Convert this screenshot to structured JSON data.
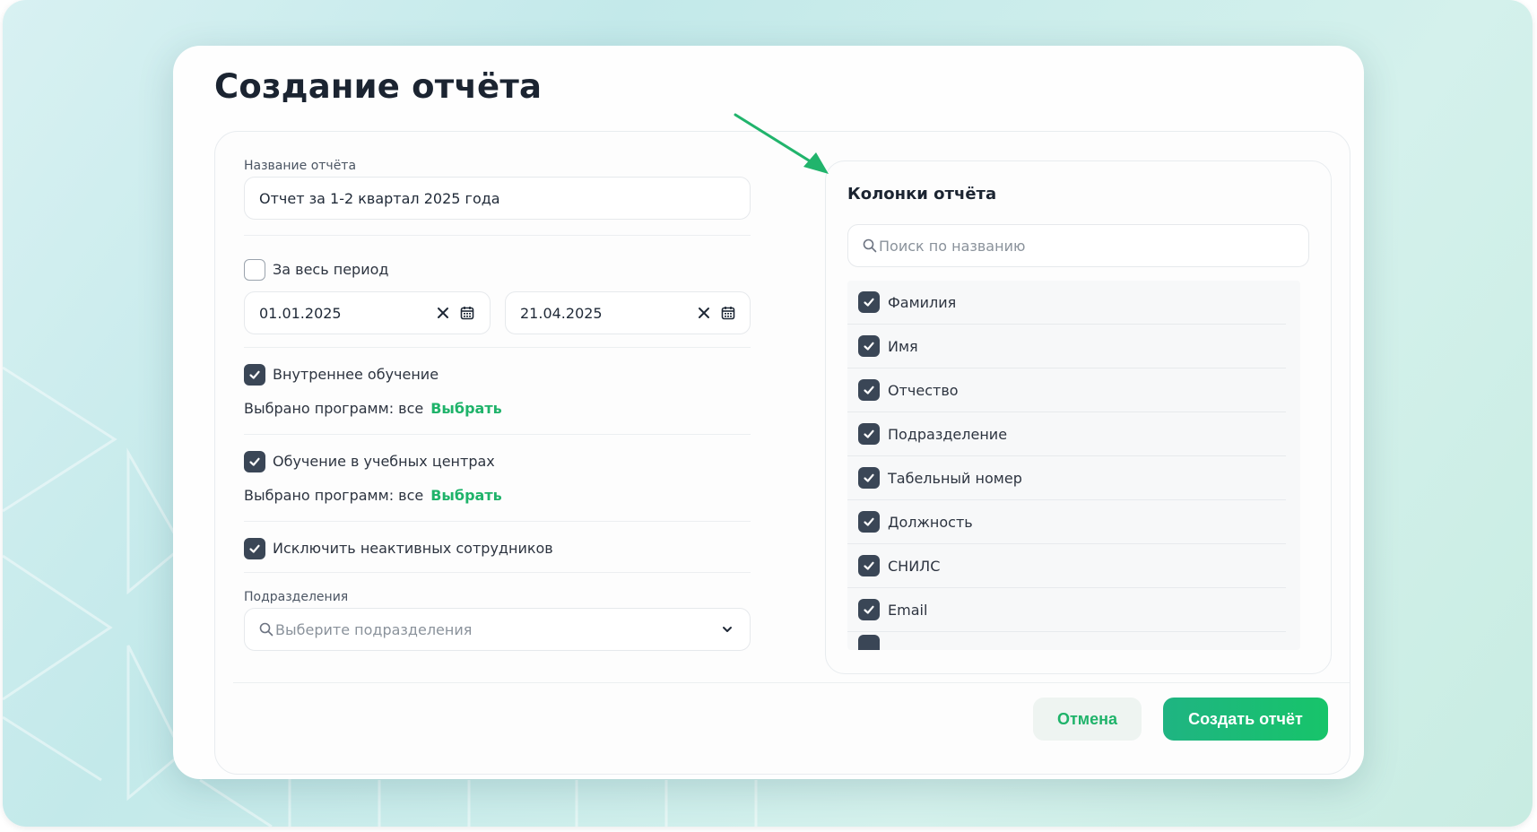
{
  "modal": {
    "title": "Создание отчёта",
    "report_name": {
      "label": "Название отчёта",
      "value": "Отчет за 1-2 квартал 2025 года"
    },
    "whole_period": {
      "label": "За весь период",
      "checked": false
    },
    "date_from": "01.01.2025",
    "date_to": "21.04.2025",
    "internal_training": {
      "label": "Внутреннее обучение",
      "checked": true,
      "selected_text": "Выбрано программ: все",
      "link": "Выбрать"
    },
    "center_training": {
      "label": "Обучение в учебных центрах",
      "checked": true,
      "selected_text": "Выбрано программ: все",
      "link": "Выбрать"
    },
    "exclude_inactive": {
      "label": "Исключить неактивных сотрудников",
      "checked": true
    },
    "departments": {
      "label": "Подразделения",
      "placeholder": "Выберите подразделения"
    },
    "columns": {
      "title": "Колонки отчёта",
      "search_placeholder": "Поиск по названию",
      "items": [
        {
          "label": "Фамилия",
          "checked": true
        },
        {
          "label": "Имя",
          "checked": true
        },
        {
          "label": "Отчество",
          "checked": true
        },
        {
          "label": "Подразделение",
          "checked": true
        },
        {
          "label": "Табельный номер",
          "checked": true
        },
        {
          "label": "Должность",
          "checked": true
        },
        {
          "label": "СНИЛС",
          "checked": true
        },
        {
          "label": "Email",
          "checked": true
        }
      ]
    },
    "buttons": {
      "cancel": "Отмена",
      "create": "Создать отчёт"
    }
  },
  "colors": {
    "accent": "#1fb36a",
    "checkbox": "#3a4656",
    "annotation_arrow": "#21b46c"
  }
}
